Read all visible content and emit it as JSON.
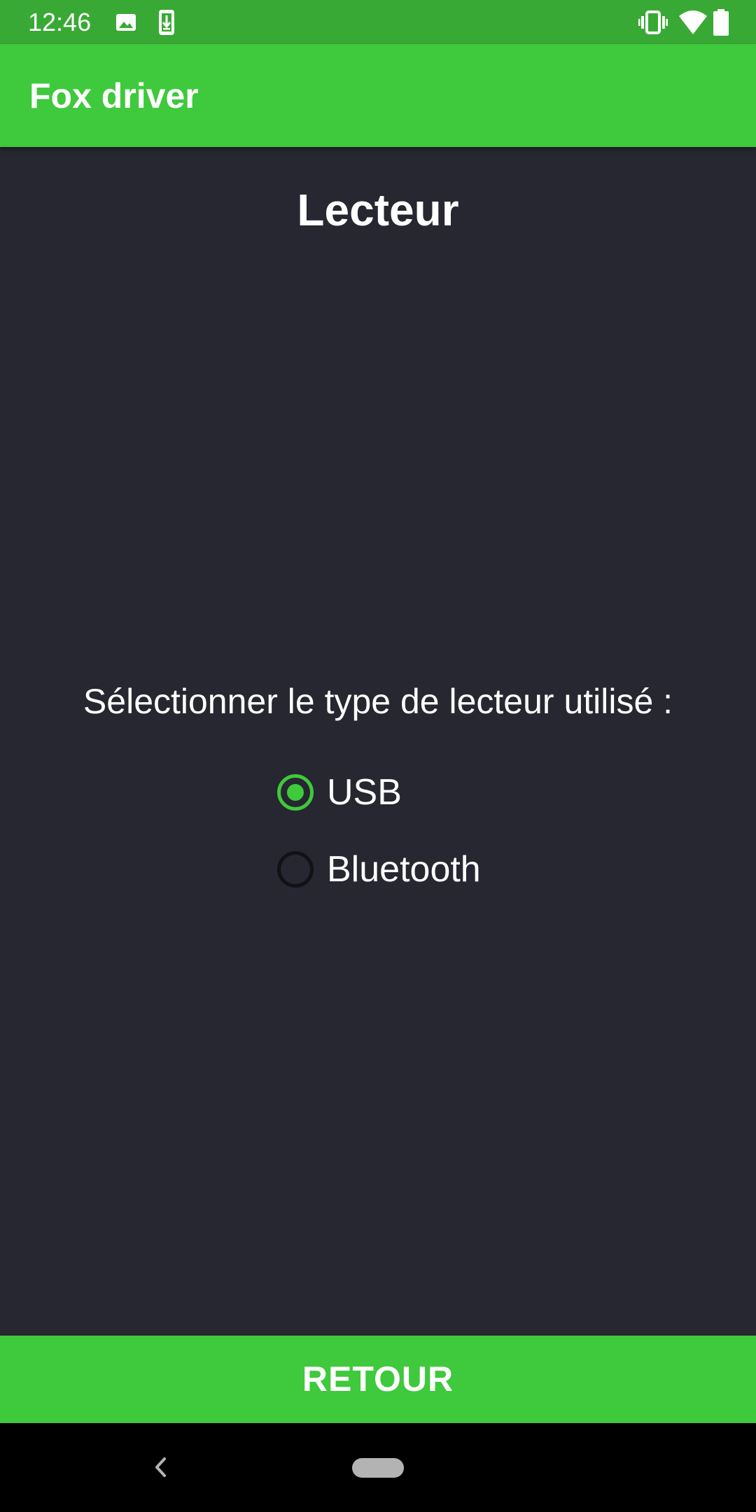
{
  "status_bar": {
    "time": "12:46",
    "icons_left": [
      "image-icon",
      "download-icon"
    ],
    "icons_right": [
      "vibrate-icon",
      "wifi-icon",
      "battery-icon"
    ]
  },
  "app_bar": {
    "title": "Fox driver"
  },
  "page": {
    "heading": "Lecteur",
    "prompt": "Sélectionner le type de lecteur utilisé :",
    "options": [
      {
        "label": "USB",
        "selected": true
      },
      {
        "label": "Bluetooth",
        "selected": false
      }
    ]
  },
  "actions": {
    "back_label": "RETOUR"
  },
  "nav_bar": {
    "icons": [
      "back-icon",
      "home-pill-icon"
    ]
  },
  "colors": {
    "status_bar": "#39a935",
    "accent": "#3fc93c",
    "background": "#262730",
    "nav_bar": "#000000",
    "text": "#ffffff"
  }
}
